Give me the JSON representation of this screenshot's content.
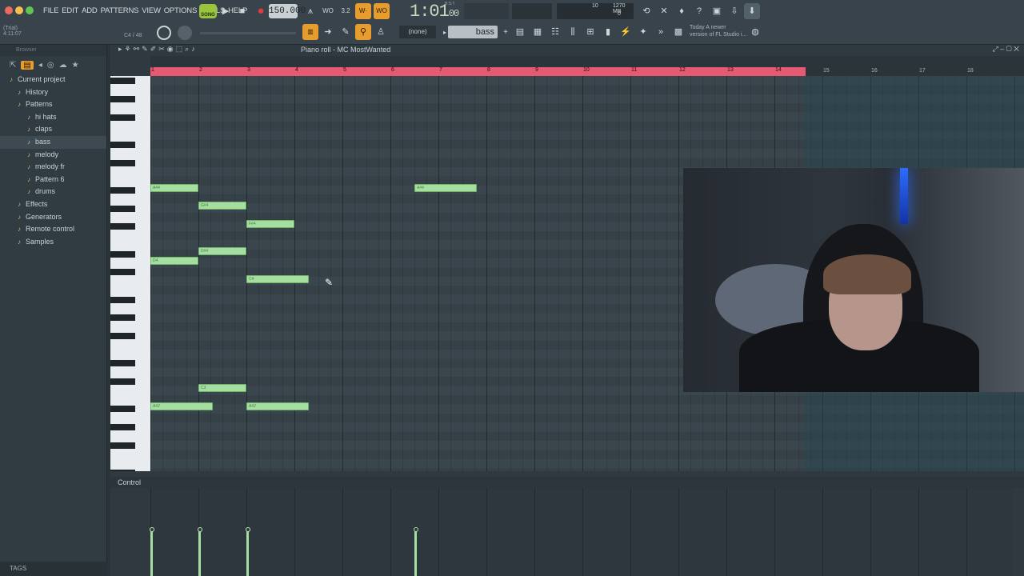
{
  "menu": [
    "FILE",
    "EDIT",
    "ADD",
    "PATTERNS",
    "VIEW",
    "OPTIONS",
    "TOOLS",
    "HELP"
  ],
  "transport": {
    "song_label": "SONG",
    "tempo": "150.000",
    "time": "1:01",
    "time_sub": "00",
    "bst": "B:S:T"
  },
  "status": {
    "trial": "(Trial)",
    "position": "4:11:07",
    "note": "C4 / 48"
  },
  "cpu": {
    "poly": "10",
    "mem": "1270 MB",
    "val": "0"
  },
  "pattern_selector": "(none)",
  "channel_selector": "bass",
  "news": {
    "line1": "Today  A newer",
    "line2": "version of FL Studio i..."
  },
  "browser": {
    "search": "Browser",
    "items": [
      {
        "label": "Current project",
        "icon": "folder-icon",
        "indent": 12
      },
      {
        "label": "History",
        "icon": "history-icon",
        "indent": 22
      },
      {
        "label": "Patterns",
        "icon": "patterns-icon",
        "indent": 22
      },
      {
        "label": "hi hats",
        "icon": "note-icon",
        "indent": 34
      },
      {
        "label": "claps",
        "icon": "note-icon",
        "indent": 34
      },
      {
        "label": "bass",
        "icon": "note-icon",
        "indent": 34,
        "selected": true
      },
      {
        "label": "melody",
        "icon": "note-icon",
        "indent": 34
      },
      {
        "label": "melody fr",
        "icon": "note-icon",
        "indent": 34
      },
      {
        "label": "Pattern 6",
        "icon": "note-icon",
        "indent": 34
      },
      {
        "label": "drums",
        "icon": "note-icon",
        "indent": 34
      },
      {
        "label": "Effects",
        "icon": "effects-icon",
        "indent": 22
      },
      {
        "label": "Generators",
        "icon": "generators-icon",
        "indent": 22
      },
      {
        "label": "Remote control",
        "icon": "remote-icon",
        "indent": 22
      },
      {
        "label": "Samples",
        "icon": "samples-icon",
        "indent": 22
      }
    ],
    "tags": "TAGS"
  },
  "piano_roll": {
    "title": "Piano roll - MC MostWanted",
    "control_label": "Control",
    "bars": [
      "1",
      "2",
      "3",
      "4",
      "5",
      "6",
      "7",
      "8",
      "9",
      "10",
      "11",
      "12",
      "13",
      "14",
      "15",
      "16",
      "17",
      "18"
    ],
    "notes": [
      {
        "label": "A#4",
        "start": 1.0,
        "length": 1.0,
        "row": 0
      },
      {
        "label": "G#4",
        "start": 2.0,
        "length": 1.0,
        "row": 2
      },
      {
        "label": "F#4",
        "start": 3.0,
        "length": 1.0,
        "row": 4
      },
      {
        "label": "D#4",
        "start": 2.0,
        "length": 1.0,
        "row": 7
      },
      {
        "label": "D4",
        "start": 1.0,
        "length": 1.0,
        "row": 8
      },
      {
        "label": "C4",
        "start": 3.0,
        "length": 1.3,
        "row": 10
      },
      {
        "label": "A#4",
        "start": 6.5,
        "length": 1.3,
        "row": 0
      },
      {
        "label": "C3",
        "start": 2.0,
        "length": 1.0,
        "row": 22
      },
      {
        "label": "A#2",
        "start": 1.0,
        "length": 1.3,
        "row": 24
      },
      {
        "label": "A#2",
        "start": 3.0,
        "length": 1.3,
        "row": 24
      }
    ]
  }
}
